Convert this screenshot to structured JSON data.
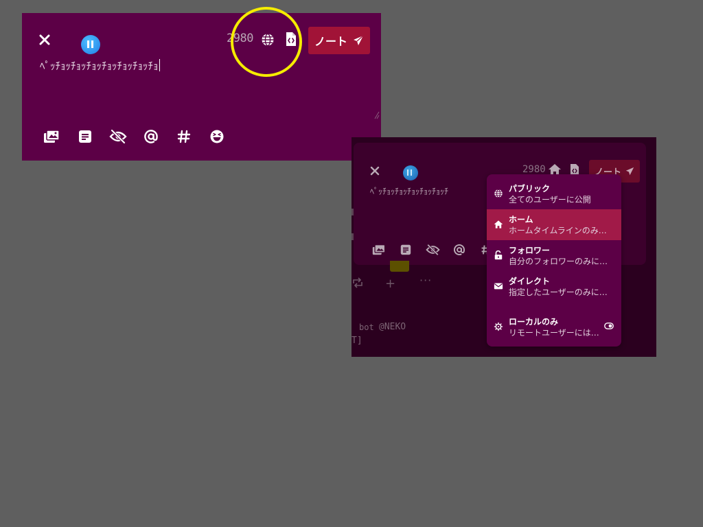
{
  "composer": {
    "counter": "2980",
    "note_button": "ノート",
    "text": "ﾍﾟｯﾁｮｯﾁｮｯﾁｮｯﾁｮｯﾁｮｯﾁｮｯﾁｮ",
    "toolbar_icons": [
      "attach-media-icon",
      "poll-icon",
      "content-warning-icon",
      "mention-icon",
      "hashtag-icon",
      "emoji-icon"
    ],
    "visibility_icon": "globe-icon",
    "annotation_color": "#f5ec00"
  },
  "screenshot2": {
    "counter": "2980",
    "note_button": "ノート",
    "text": "ﾍﾟｯﾁｮｯﾁｮｯﾁｮｯﾁｮｯﾁｮｯﾁ",
    "visibility_icon": "home-icon",
    "timeline": {
      "bot_label": "bot",
      "handle": "@NEKO",
      "bracket": "T]"
    },
    "menu": {
      "items": [
        {
          "icon": "globe-icon",
          "title": "パブリック",
          "desc": "全てのユーザーに公開",
          "active": false
        },
        {
          "icon": "home-icon",
          "title": "ホーム",
          "desc": "ホームタイムラインのみ…",
          "active": true
        },
        {
          "icon": "unlock-icon",
          "title": "フォロワー",
          "desc": "自分のフォロワーのみに…",
          "active": false
        },
        {
          "icon": "envelope-icon",
          "title": "ダイレクト",
          "desc": "指定したユーザーのみに…",
          "active": false
        },
        {
          "icon": "virus-icon",
          "title": "ローカルのみ",
          "desc": "リモートユーザーには…",
          "active": false
        }
      ],
      "local_only_toggle": "off"
    }
  },
  "colors": {
    "background": "#5f5f5f",
    "panel": "#5c0046",
    "accent": "#a11337",
    "active_item": "#a11a48"
  }
}
